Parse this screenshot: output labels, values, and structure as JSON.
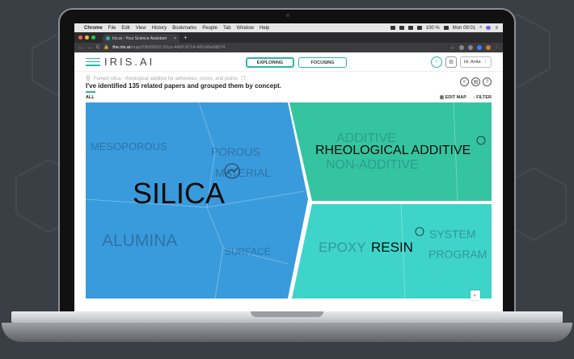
{
  "menubar": {
    "app": "Chrome",
    "items": [
      "File",
      "Edit",
      "View",
      "History",
      "Bookmarks",
      "People",
      "Tab",
      "Window",
      "Help"
    ],
    "battery": "100 %",
    "clock": "Mon 09:01"
  },
  "browser": {
    "tab_title": "Iris.ai - Your Science Assistant",
    "url_host": "the.iris.ai",
    "url_path": "/map/33b99582-33ca-4400-9714-4f9146e68674"
  },
  "header": {
    "logo": "IRIS.AI",
    "mode_exploring": "EXPLORING",
    "mode_focusing": "FOCUSING",
    "info_icon": "i",
    "user_label": "Hi, Anita"
  },
  "query": {
    "text": "Fumed silica - rheological additive for adhesives, resins, and points",
    "summary": "I've identified 135 related papers and grouped them by concept.",
    "filter_all": "ALL",
    "edit_map": "EDIT MAP",
    "filter": "FILTER"
  },
  "map": {
    "colors": {
      "blue": "#3a9bdc",
      "green": "#35c4a0",
      "teal": "#3fd4c9"
    },
    "concepts": {
      "silica": "SILICA",
      "mesoporous": "MESOPOROUS",
      "porous": "POROUS",
      "material": "MATERIAL",
      "alumina": "ALUMINA",
      "surface": "SURFACE",
      "rheological": "RHEOLOGICAL ADDITIVE",
      "additive": "ADDITIVE",
      "non_additive": "NON-ADDITIVE",
      "epoxy": "EPOXY",
      "resin": "RESIN",
      "system": "SYSTEM",
      "program": "PROGRAM"
    }
  }
}
